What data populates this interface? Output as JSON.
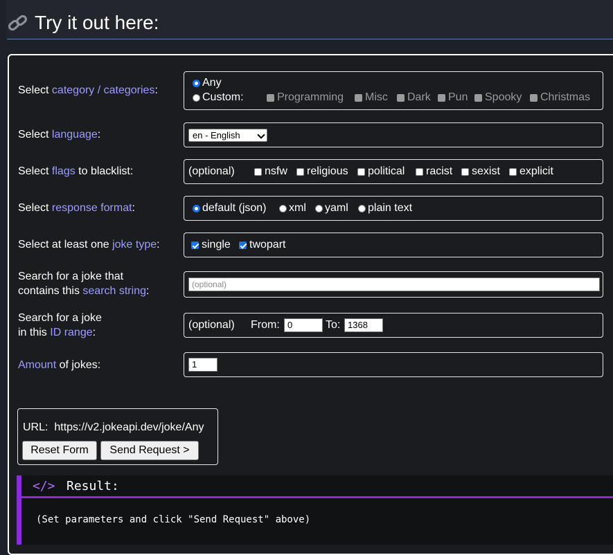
{
  "header": {
    "title": "Try it out here:"
  },
  "category": {
    "label_prefix": "Select ",
    "label_link": "category / categories",
    "label_suffix": ":",
    "any_label": "Any",
    "custom_label": "Custom:",
    "options": [
      "Programming",
      "Misc",
      "Dark",
      "Pun",
      "Spooky",
      "Christmas"
    ]
  },
  "language": {
    "label_prefix": "Select ",
    "label_link": "language",
    "label_suffix": ":",
    "selected": "en - English"
  },
  "flags": {
    "label_prefix": "Select ",
    "label_link": "flags",
    "label_suffix": " to blacklist:",
    "optional": "(optional)",
    "options": [
      "nsfw",
      "religious",
      "political",
      "racist",
      "sexist",
      "explicit"
    ]
  },
  "format": {
    "label_prefix": "Select ",
    "label_link": "response format",
    "label_suffix": ":",
    "options": [
      "default (json)",
      "xml",
      "yaml",
      "plain text"
    ]
  },
  "joke_type": {
    "label_prefix": "Select at least one ",
    "label_link": "joke type",
    "label_suffix": ":",
    "options": [
      "single",
      "twopart"
    ]
  },
  "search": {
    "label_line1": "Search for a joke that",
    "label_prefix": "contains this ",
    "label_link": "search string",
    "label_suffix": ":",
    "placeholder": "(optional)"
  },
  "id_range": {
    "label_line1": "Search for a joke",
    "label_prefix": "in this ",
    "label_link": "ID range",
    "label_suffix": ":",
    "optional": "(optional)",
    "from_label": "From:",
    "from_value": "0",
    "to_label": "To:",
    "to_value": "1368"
  },
  "amount": {
    "label_link": "Amount",
    "label_suffix": " of jokes:",
    "value": "1"
  },
  "url_box": {
    "url_label": "URL:",
    "url_value": "https://v2.jokeapi.dev/joke/Any",
    "reset_label": "Reset Form",
    "send_label": "Send Request >"
  },
  "result": {
    "code_icon": "</>",
    "title": "Result:",
    "message": "(Set parameters and click \"Send Request\" above)"
  },
  "colors": {
    "accent": "#9b9dff",
    "result_accent": "#8a2be2",
    "header_rule": "#5a7fb8"
  }
}
